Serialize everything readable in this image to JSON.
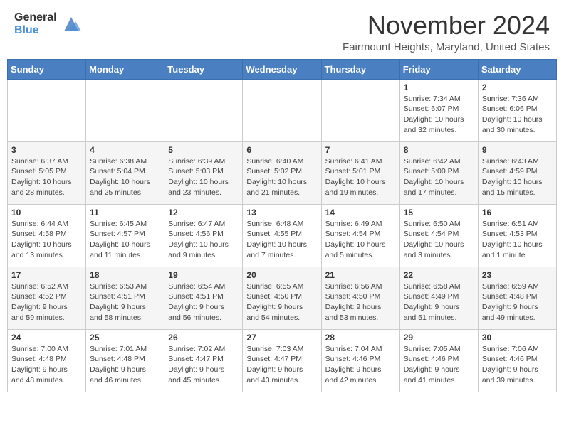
{
  "header": {
    "logo_general": "General",
    "logo_blue": "Blue",
    "month": "November 2024",
    "location": "Fairmount Heights, Maryland, United States"
  },
  "calendar": {
    "days_of_week": [
      "Sunday",
      "Monday",
      "Tuesday",
      "Wednesday",
      "Thursday",
      "Friday",
      "Saturday"
    ],
    "weeks": [
      [
        {
          "day": "",
          "info": ""
        },
        {
          "day": "",
          "info": ""
        },
        {
          "day": "",
          "info": ""
        },
        {
          "day": "",
          "info": ""
        },
        {
          "day": "",
          "info": ""
        },
        {
          "day": "1",
          "info": "Sunrise: 7:34 AM\nSunset: 6:07 PM\nDaylight: 10 hours and 32 minutes."
        },
        {
          "day": "2",
          "info": "Sunrise: 7:36 AM\nSunset: 6:06 PM\nDaylight: 10 hours and 30 minutes."
        }
      ],
      [
        {
          "day": "3",
          "info": "Sunrise: 6:37 AM\nSunset: 5:05 PM\nDaylight: 10 hours and 28 minutes."
        },
        {
          "day": "4",
          "info": "Sunrise: 6:38 AM\nSunset: 5:04 PM\nDaylight: 10 hours and 25 minutes."
        },
        {
          "day": "5",
          "info": "Sunrise: 6:39 AM\nSunset: 5:03 PM\nDaylight: 10 hours and 23 minutes."
        },
        {
          "day": "6",
          "info": "Sunrise: 6:40 AM\nSunset: 5:02 PM\nDaylight: 10 hours and 21 minutes."
        },
        {
          "day": "7",
          "info": "Sunrise: 6:41 AM\nSunset: 5:01 PM\nDaylight: 10 hours and 19 minutes."
        },
        {
          "day": "8",
          "info": "Sunrise: 6:42 AM\nSunset: 5:00 PM\nDaylight: 10 hours and 17 minutes."
        },
        {
          "day": "9",
          "info": "Sunrise: 6:43 AM\nSunset: 4:59 PM\nDaylight: 10 hours and 15 minutes."
        }
      ],
      [
        {
          "day": "10",
          "info": "Sunrise: 6:44 AM\nSunset: 4:58 PM\nDaylight: 10 hours and 13 minutes."
        },
        {
          "day": "11",
          "info": "Sunrise: 6:45 AM\nSunset: 4:57 PM\nDaylight: 10 hours and 11 minutes."
        },
        {
          "day": "12",
          "info": "Sunrise: 6:47 AM\nSunset: 4:56 PM\nDaylight: 10 hours and 9 minutes."
        },
        {
          "day": "13",
          "info": "Sunrise: 6:48 AM\nSunset: 4:55 PM\nDaylight: 10 hours and 7 minutes."
        },
        {
          "day": "14",
          "info": "Sunrise: 6:49 AM\nSunset: 4:54 PM\nDaylight: 10 hours and 5 minutes."
        },
        {
          "day": "15",
          "info": "Sunrise: 6:50 AM\nSunset: 4:54 PM\nDaylight: 10 hours and 3 minutes."
        },
        {
          "day": "16",
          "info": "Sunrise: 6:51 AM\nSunset: 4:53 PM\nDaylight: 10 hours and 1 minute."
        }
      ],
      [
        {
          "day": "17",
          "info": "Sunrise: 6:52 AM\nSunset: 4:52 PM\nDaylight: 9 hours and 59 minutes."
        },
        {
          "day": "18",
          "info": "Sunrise: 6:53 AM\nSunset: 4:51 PM\nDaylight: 9 hours and 58 minutes."
        },
        {
          "day": "19",
          "info": "Sunrise: 6:54 AM\nSunset: 4:51 PM\nDaylight: 9 hours and 56 minutes."
        },
        {
          "day": "20",
          "info": "Sunrise: 6:55 AM\nSunset: 4:50 PM\nDaylight: 9 hours and 54 minutes."
        },
        {
          "day": "21",
          "info": "Sunrise: 6:56 AM\nSunset: 4:50 PM\nDaylight: 9 hours and 53 minutes."
        },
        {
          "day": "22",
          "info": "Sunrise: 6:58 AM\nSunset: 4:49 PM\nDaylight: 9 hours and 51 minutes."
        },
        {
          "day": "23",
          "info": "Sunrise: 6:59 AM\nSunset: 4:48 PM\nDaylight: 9 hours and 49 minutes."
        }
      ],
      [
        {
          "day": "24",
          "info": "Sunrise: 7:00 AM\nSunset: 4:48 PM\nDaylight: 9 hours and 48 minutes."
        },
        {
          "day": "25",
          "info": "Sunrise: 7:01 AM\nSunset: 4:48 PM\nDaylight: 9 hours and 46 minutes."
        },
        {
          "day": "26",
          "info": "Sunrise: 7:02 AM\nSunset: 4:47 PM\nDaylight: 9 hours and 45 minutes."
        },
        {
          "day": "27",
          "info": "Sunrise: 7:03 AM\nSunset: 4:47 PM\nDaylight: 9 hours and 43 minutes."
        },
        {
          "day": "28",
          "info": "Sunrise: 7:04 AM\nSunset: 4:46 PM\nDaylight: 9 hours and 42 minutes."
        },
        {
          "day": "29",
          "info": "Sunrise: 7:05 AM\nSunset: 4:46 PM\nDaylight: 9 hours and 41 minutes."
        },
        {
          "day": "30",
          "info": "Sunrise: 7:06 AM\nSunset: 4:46 PM\nDaylight: 9 hours and 39 minutes."
        }
      ]
    ]
  }
}
